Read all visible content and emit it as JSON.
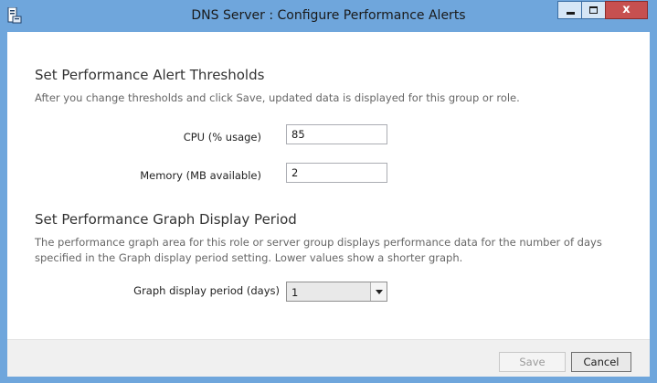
{
  "window": {
    "title": "DNS Server : Configure Performance Alerts",
    "close_glyph": "x",
    "icons": [
      "server-app-icon",
      "minimize-icon",
      "maximize-icon",
      "close-icon"
    ]
  },
  "thresholds": {
    "heading": "Set Performance Alert Thresholds",
    "description": "After you change thresholds and click Save, updated data is displayed for this group or role.",
    "cpu_label": "CPU (% usage)",
    "cpu_value": "85",
    "memory_label": "Memory (MB available)",
    "memory_value": "2"
  },
  "graph": {
    "heading": "Set Performance Graph Display Period",
    "description_line1": "The performance graph area for this role or server group displays performance data for the number of days",
    "description_line2": "specified in the Graph display period setting. Lower values show a shorter graph.",
    "period_label": "Graph display period (days)",
    "period_value": "1"
  },
  "footer": {
    "save_label": "Save",
    "cancel_label": "Cancel"
  },
  "colors": {
    "titlebar": "#6fa6dc",
    "close_button": "#c75050",
    "footer": "#f0f0f0"
  }
}
